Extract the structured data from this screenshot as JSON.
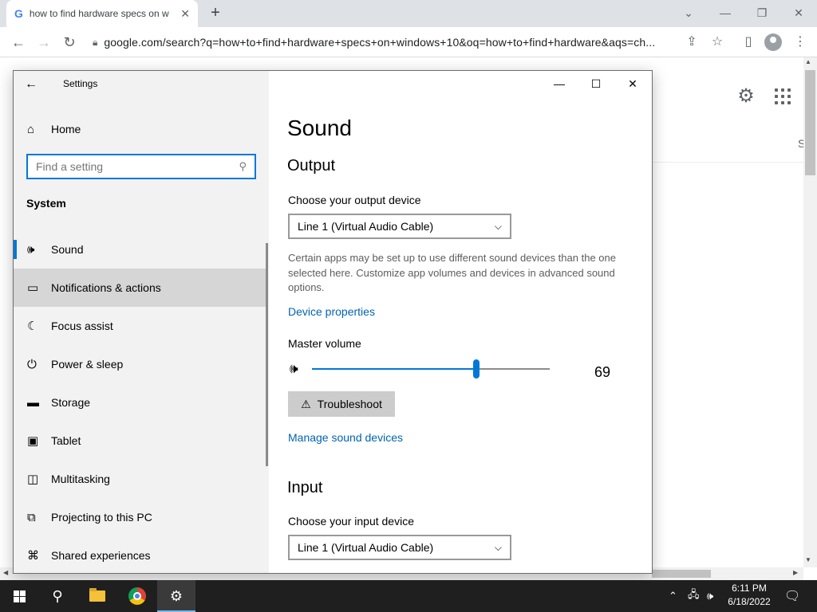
{
  "browser": {
    "tab_title": "how to find hardware specs on w",
    "tab_favicon": "G",
    "url": "google.com/search?q=how+to+find+hardware+specs+on+windows+10&oq=how+to+find+hardware&aqs=ch..."
  },
  "page": {
    "partial_text": "S"
  },
  "settings": {
    "window_title": "Settings",
    "home_label": "Home",
    "search_placeholder": "Find a setting",
    "section": "System",
    "nav": [
      {
        "label": "Sound",
        "icon": "speaker-icon",
        "selected": true
      },
      {
        "label": "Notifications & actions",
        "icon": "notification-icon"
      },
      {
        "label": "Focus assist",
        "icon": "moon-icon"
      },
      {
        "label": "Power & sleep",
        "icon": "power-icon"
      },
      {
        "label": "Storage",
        "icon": "storage-icon"
      },
      {
        "label": "Tablet",
        "icon": "tablet-icon"
      },
      {
        "label": "Multitasking",
        "icon": "multitasking-icon"
      },
      {
        "label": "Projecting to this PC",
        "icon": "projecting-icon"
      },
      {
        "label": "Shared experiences",
        "icon": "shared-icon"
      }
    ],
    "content": {
      "title": "Sound",
      "output_heading": "Output",
      "output_device_label": "Choose your output device",
      "output_device_value": "Line 1 (Virtual Audio Cable)",
      "description": "Certain apps may be set up to use different sound devices than the one selected here. Customize app volumes and devices in advanced sound options.",
      "device_properties_link": "Device properties",
      "master_volume_label": "Master volume",
      "volume": 69,
      "troubleshoot_label": "Troubleshoot",
      "manage_devices_link": "Manage sound devices",
      "input_heading": "Input",
      "input_device_label": "Choose your input device",
      "input_device_value": "Line 1 (Virtual Audio Cable)"
    }
  },
  "taskbar": {
    "time": "6:11 PM",
    "date": "6/18/2022"
  },
  "colors": {
    "accent": "#0078d7",
    "link": "#0063b1",
    "taskbar": "#1f1f1f"
  }
}
